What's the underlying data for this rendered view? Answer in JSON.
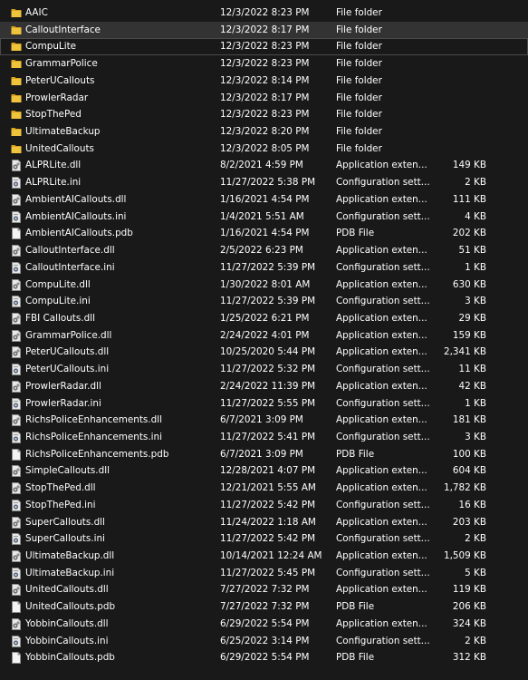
{
  "files": [
    {
      "name": "AAIC",
      "date": "12/3/2022 8:23 PM",
      "type": "File folder",
      "size": "",
      "icon": "folder-icon"
    },
    {
      "name": "CalloutInterface",
      "date": "12/3/2022 8:17 PM",
      "type": "File folder",
      "size": "",
      "icon": "folder-icon"
    },
    {
      "name": "CompuLite",
      "date": "12/3/2022 8:23 PM",
      "type": "File folder",
      "size": "",
      "icon": "folder-icon"
    },
    {
      "name": "GrammarPolice",
      "date": "12/3/2022 8:23 PM",
      "type": "File folder",
      "size": "",
      "icon": "folder-icon"
    },
    {
      "name": "PeterUCallouts",
      "date": "12/3/2022 8:14 PM",
      "type": "File folder",
      "size": "",
      "icon": "folder-icon"
    },
    {
      "name": "ProwlerRadar",
      "date": "12/3/2022 8:17 PM",
      "type": "File folder",
      "size": "",
      "icon": "folder-icon"
    },
    {
      "name": "StopThePed",
      "date": "12/3/2022 8:23 PM",
      "type": "File folder",
      "size": "",
      "icon": "folder-icon"
    },
    {
      "name": "UltimateBackup",
      "date": "12/3/2022 8:20 PM",
      "type": "File folder",
      "size": "",
      "icon": "folder-icon"
    },
    {
      "name": "UnitedCallouts",
      "date": "12/3/2022 8:05 PM",
      "type": "File folder",
      "size": "",
      "icon": "folder-icon"
    },
    {
      "name": "ALPRLite.dll",
      "date": "8/2/2021 4:59 PM",
      "type": "Application exten...",
      "size": "149 KB",
      "icon": "dll-file-icon"
    },
    {
      "name": "ALPRLite.ini",
      "date": "11/27/2022 5:38 PM",
      "type": "Configuration sett...",
      "size": "2 KB",
      "icon": "config-file-icon"
    },
    {
      "name": "AmbientAICallouts.dll",
      "date": "1/16/2021 4:54 PM",
      "type": "Application exten...",
      "size": "111 KB",
      "icon": "dll-file-icon"
    },
    {
      "name": "AmbientAICallouts.ini",
      "date": "1/4/2021 5:51 AM",
      "type": "Configuration sett...",
      "size": "4 KB",
      "icon": "config-file-icon"
    },
    {
      "name": "AmbientAICallouts.pdb",
      "date": "1/16/2021 4:54 PM",
      "type": "PDB File",
      "size": "202 KB",
      "icon": "blank-file-icon"
    },
    {
      "name": "CalloutInterface.dll",
      "date": "2/5/2022 6:23 PM",
      "type": "Application exten...",
      "size": "51 KB",
      "icon": "dll-file-icon"
    },
    {
      "name": "CalloutInterface.ini",
      "date": "11/27/2022 5:39 PM",
      "type": "Configuration sett...",
      "size": "1 KB",
      "icon": "config-file-icon"
    },
    {
      "name": "CompuLite.dll",
      "date": "1/30/2022 8:01 AM",
      "type": "Application exten...",
      "size": "630 KB",
      "icon": "dll-file-icon"
    },
    {
      "name": "CompuLite.ini",
      "date": "11/27/2022 5:39 PM",
      "type": "Configuration sett...",
      "size": "3 KB",
      "icon": "config-file-icon"
    },
    {
      "name": "FBI Callouts.dll",
      "date": "1/25/2022 6:21 PM",
      "type": "Application exten...",
      "size": "29 KB",
      "icon": "dll-file-icon"
    },
    {
      "name": "GrammarPolice.dll",
      "date": "2/24/2022 4:01 PM",
      "type": "Application exten...",
      "size": "159 KB",
      "icon": "dll-file-icon"
    },
    {
      "name": "PeterUCallouts.dll",
      "date": "10/25/2020 5:44 PM",
      "type": "Application exten...",
      "size": "2,341 KB",
      "icon": "dll-file-icon"
    },
    {
      "name": "PeterUCallouts.ini",
      "date": "11/27/2022 5:32 PM",
      "type": "Configuration sett...",
      "size": "11 KB",
      "icon": "config-file-icon"
    },
    {
      "name": "ProwlerRadar.dll",
      "date": "2/24/2022 11:39 PM",
      "type": "Application exten...",
      "size": "42 KB",
      "icon": "dll-file-icon"
    },
    {
      "name": "ProwlerRadar.ini",
      "date": "11/27/2022 5:55 PM",
      "type": "Configuration sett...",
      "size": "1 KB",
      "icon": "config-file-icon"
    },
    {
      "name": "RichsPoliceEnhancements.dll",
      "date": "6/7/2021 3:09 PM",
      "type": "Application exten...",
      "size": "181 KB",
      "icon": "dll-file-icon"
    },
    {
      "name": "RichsPoliceEnhancements.ini",
      "date": "11/27/2022 5:41 PM",
      "type": "Configuration sett...",
      "size": "3 KB",
      "icon": "config-file-icon"
    },
    {
      "name": "RichsPoliceEnhancements.pdb",
      "date": "6/7/2021 3:09 PM",
      "type": "PDB File",
      "size": "100 KB",
      "icon": "blank-file-icon"
    },
    {
      "name": "SimpleCallouts.dll",
      "date": "12/28/2021 4:07 PM",
      "type": "Application exten...",
      "size": "604 KB",
      "icon": "dll-file-icon"
    },
    {
      "name": "StopThePed.dll",
      "date": "12/21/2021 5:55 AM",
      "type": "Application exten...",
      "size": "1,782 KB",
      "icon": "dll-file-icon"
    },
    {
      "name": "StopThePed.ini",
      "date": "11/27/2022 5:42 PM",
      "type": "Configuration sett...",
      "size": "16 KB",
      "icon": "config-file-icon"
    },
    {
      "name": "SuperCallouts.dll",
      "date": "11/24/2022 1:18 AM",
      "type": "Application exten...",
      "size": "203 KB",
      "icon": "dll-file-icon"
    },
    {
      "name": "SuperCallouts.ini",
      "date": "11/27/2022 5:42 PM",
      "type": "Configuration sett...",
      "size": "2 KB",
      "icon": "config-file-icon"
    },
    {
      "name": "UltimateBackup.dll",
      "date": "10/14/2021 12:24 AM",
      "type": "Application exten...",
      "size": "1,509 KB",
      "icon": "dll-file-icon"
    },
    {
      "name": "UltimateBackup.ini",
      "date": "11/27/2022 5:45 PM",
      "type": "Configuration sett...",
      "size": "5 KB",
      "icon": "config-file-icon"
    },
    {
      "name": "UnitedCallouts.dll",
      "date": "7/27/2022 7:32 PM",
      "type": "Application exten...",
      "size": "119 KB",
      "icon": "dll-file-icon"
    },
    {
      "name": "UnitedCallouts.pdb",
      "date": "7/27/2022 7:32 PM",
      "type": "PDB File",
      "size": "206 KB",
      "icon": "blank-file-icon"
    },
    {
      "name": "YobbinCallouts.dll",
      "date": "6/29/2022 5:54 PM",
      "type": "Application exten...",
      "size": "324 KB",
      "icon": "dll-file-icon"
    },
    {
      "name": "YobbinCallouts.ini",
      "date": "6/25/2022 3:14 PM",
      "type": "Configuration sett...",
      "size": "2 KB",
      "icon": "config-file-icon"
    },
    {
      "name": "YobbinCallouts.pdb",
      "date": "6/29/2022 5:54 PM",
      "type": "PDB File",
      "size": "312 KB",
      "icon": "blank-file-icon"
    }
  ],
  "selected_index": 1,
  "focused_index": 2,
  "colors": {
    "background": "#191919",
    "selected_row": "#333333",
    "text": "#ffffff",
    "folder_yellow": "#f0c33c",
    "folder_dark": "#d9a21b"
  }
}
